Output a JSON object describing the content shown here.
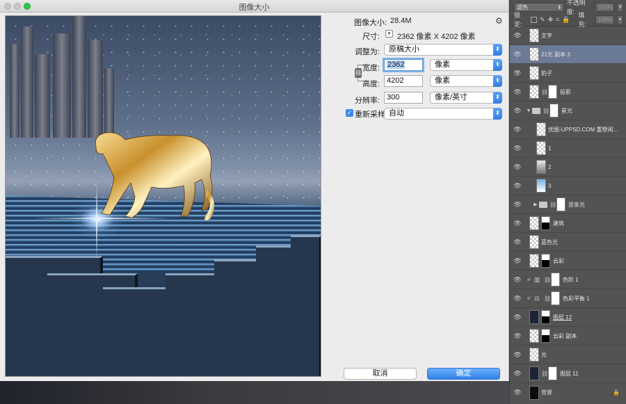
{
  "dialog": {
    "title": "图像大小",
    "image_size_label": "图像大小:",
    "image_size_value": "28.4M",
    "dimensions_label": "尺寸:",
    "dimensions_value": "2362 像素  X  4202 像素",
    "fit_to_label": "调整为:",
    "fit_to_value": "原稿大小",
    "width_label": "宽度:",
    "width_value": "2362",
    "width_unit": "像素",
    "height_label": "高度:",
    "height_value": "4202",
    "height_unit": "像素",
    "resolution_label": "分辨率:",
    "resolution_value": "300",
    "resolution_unit": "像素/英寸",
    "resample_label": "重新采样:",
    "resample_value": "自动",
    "resample_checked": true,
    "cancel_label": "取消",
    "ok_label": "确定",
    "accent_color": "#3d88ec"
  },
  "layers_panel": {
    "blend_mode": "滤色",
    "opacity_label": "不透明度:",
    "opacity_value": "100%",
    "lock_label": "锁定:",
    "fill_label": "填充:",
    "fill_value": "100%",
    "layers": [
      {
        "name": "文字"
      },
      {
        "name": "21光 副本 3",
        "selected": true
      },
      {
        "name": "豹子"
      },
      {
        "name": "投影"
      },
      {
        "name": "星光",
        "group": true,
        "expanded": true
      },
      {
        "name": "优图-UPPSD.COM 重塑闲..."
      },
      {
        "name": "1"
      },
      {
        "name": "2"
      },
      {
        "name": "3"
      },
      {
        "name": "竖条光",
        "group": true,
        "expanded": false
      },
      {
        "name": "建筑"
      },
      {
        "name": "蓝色光"
      },
      {
        "name": "云彩"
      },
      {
        "name": "色阶 1",
        "adjustment": "levels-icon"
      },
      {
        "name": "色彩平衡 1",
        "adjustment": "balance-icon"
      },
      {
        "name": "图层 12"
      },
      {
        "name": "云彩 副本"
      },
      {
        "name": "光"
      },
      {
        "name": "图层 11"
      },
      {
        "name": "背景",
        "locked": true
      }
    ]
  }
}
